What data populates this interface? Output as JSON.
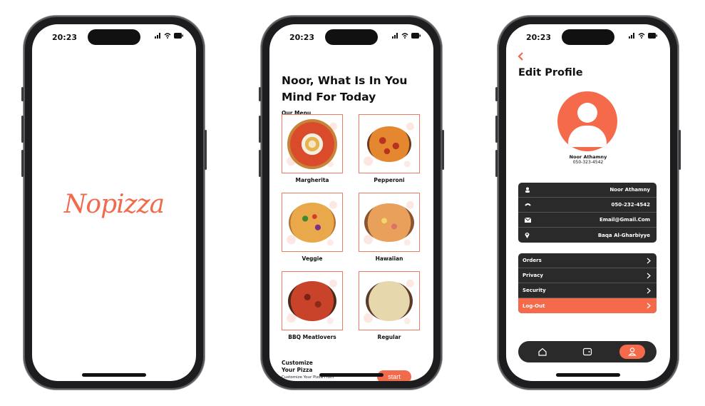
{
  "colors": {
    "accent": "#f16a4c",
    "dark_panel": "#2a2a2a"
  },
  "status": {
    "time": "20:23"
  },
  "splash": {
    "logo_text": "Nopizza"
  },
  "home": {
    "greeting": "Noor, What Is In You Mind For Today",
    "menu_label": "Our Menu",
    "items": [
      {
        "name": "Margherita"
      },
      {
        "name": "Pepperoni"
      },
      {
        "name": "Veggie"
      },
      {
        "name": "Hawaiian"
      },
      {
        "name": "BBQ Meatlovers"
      },
      {
        "name": "Regular"
      }
    ],
    "customize_title": "Customize Your Pizza",
    "customize_sub": "Customize Your Pizza From",
    "start_label": "start"
  },
  "profile": {
    "back_icon": "chevron-left-icon",
    "title": "Edit Profile",
    "name": "Noor Athamny",
    "phone": "050-323-4542",
    "info": [
      {
        "icon": "person-icon",
        "value": "Noor Athamny"
      },
      {
        "icon": "phone-icon",
        "value": "050-232-4542"
      },
      {
        "icon": "mail-icon",
        "value": "Email@Gmail.Com"
      },
      {
        "icon": "location-icon",
        "value": "Baqa Al-Gharbiyye"
      }
    ],
    "menu": [
      {
        "label": "Orders"
      },
      {
        "label": "Privacy"
      },
      {
        "label": "Security"
      },
      {
        "label": "Log-Out"
      }
    ],
    "tabs": [
      {
        "icon": "home-icon"
      },
      {
        "icon": "wallet-icon"
      },
      {
        "icon": "profile-icon",
        "active": true
      }
    ]
  }
}
